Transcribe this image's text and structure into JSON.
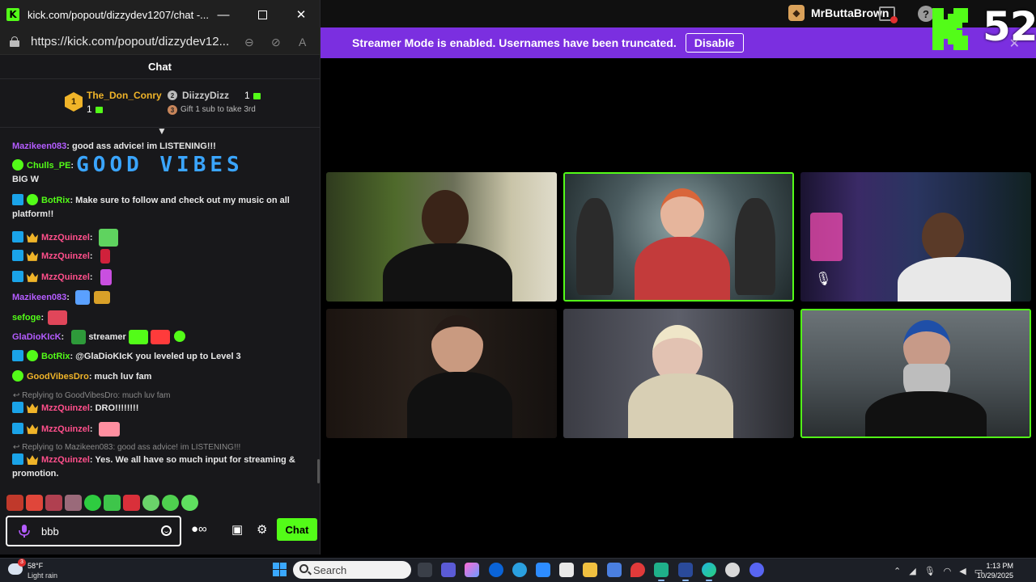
{
  "chat_window": {
    "tab_title": "kick.com/popout/dizzydev1207/chat -...",
    "url": "https://kick.com/popout/dizzydev12...",
    "header": "Chat",
    "leaderboard": {
      "first_rank": "1",
      "first_name": "The_Don_Conry",
      "first_count": "1",
      "second_rank": "2",
      "second_name": "DiizzyDizz",
      "second_count": "1",
      "third_rank": "3",
      "third_text": "Gift 1 sub to take 3rd"
    },
    "messages": [
      {
        "user": "Mazikeen083",
        "text": ": good ass advice! im LISTENING!!!",
        "color": "#b45cff"
      },
      {
        "user": "Chulls_PE",
        "text": ":",
        "color": "#53fc18",
        "emote_text": "GOOD VIBES",
        "extra": "BIG W"
      },
      {
        "user": "BotRix",
        "text": ": Make sure to follow and check out my music on all platform!!",
        "color": "#53fc18"
      },
      {
        "user": "MzzQuinzel",
        "text": ":",
        "color": "#ff4f8b"
      },
      {
        "user": "MzzQuinzel",
        "text": ":",
        "color": "#ff4f8b"
      },
      {
        "user": "MzzQuinzel",
        "text": ":",
        "color": "#ff4f8b"
      },
      {
        "user": "Mazikeen083",
        "text": ":",
        "color": "#b45cff"
      },
      {
        "user": "sefoge",
        "text": ":",
        "color": "#53fc18"
      },
      {
        "user": "GlaDioKIcK",
        "text": ":",
        "color": "#b45cff",
        "after": "streamer"
      },
      {
        "user": "BotRix",
        "text": ": @GlaDioKIcK you leveled up to Level 3",
        "color": "#53fc18"
      },
      {
        "user": "GoodVibesDro",
        "text": ": much luv fam",
        "color": "#f0b429"
      },
      {
        "reply": "Replying to GoodVibesDro: much luv fam"
      },
      {
        "user": "MzzQuinzel",
        "text": ": DRO!!!!!!!!",
        "color": "#ff4f8b"
      },
      {
        "user": "MzzQuinzel",
        "text": ":",
        "color": "#ff4f8b"
      },
      {
        "reply": "Replying to Mazikeen083: good ass advice! im LISTENING!!!"
      },
      {
        "user": "MzzQuinzel",
        "text": ": Yes. We all have so much input for streaming & promotion.",
        "color": "#ff4f8b"
      }
    ],
    "input_value": "bbb",
    "send_label": "Chat"
  },
  "stream_window": {
    "title": "MrButtaBrown",
    "banner_text": "Streamer Mode is enabled. Usernames have been truncated.",
    "banner_button": "Disable",
    "viewer_count": "52",
    "accent": "#53fc18",
    "banner_color": "#7b2fe0"
  },
  "taskbar": {
    "weather_temp": "58°F",
    "weather_desc": "Light rain",
    "weather_badge": "3",
    "search_label": "Search",
    "time": "1:13 PM",
    "date": "10/29/2025"
  }
}
